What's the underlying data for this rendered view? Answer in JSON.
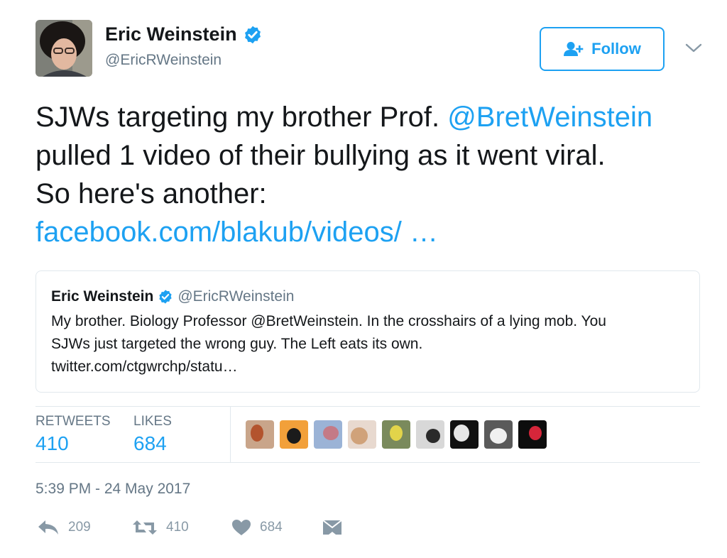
{
  "author": {
    "name": "Eric Weinstein",
    "handle": "@EricRWeinstein",
    "verified": true,
    "avatar_icon": "avatar-photo"
  },
  "follow_button": {
    "label": "Follow",
    "icon": "add-user-icon"
  },
  "menu_icon": "chevron-down-icon",
  "tweet": {
    "line1_text": "SJWs targeting my brother Prof. ",
    "line1_mention": "@BretWeinstein",
    "line2": "pulled 1 video of their bullying as it went viral.",
    "line3": "So here's another:",
    "link": "facebook.com/blakub/videos/ …"
  },
  "quoted_tweet": {
    "name": "Eric Weinstein",
    "handle": "@EricRWeinstein",
    "verified": true,
    "line1": "My brother. Biology Professor @BretWeinstein. In the crosshairs of a lying mob. You",
    "line2": "SJWs just targeted the wrong guy. The Left eats its own.",
    "line3": "twitter.com/ctgwrchp/statu…"
  },
  "stats": {
    "retweets_label": "RETWEETS",
    "retweets_value": "410",
    "likes_label": "LIKES",
    "likes_value": "684"
  },
  "likers": [
    {
      "name": "liker-1",
      "bg": "#c9a58a",
      "fg": "#b3542e"
    },
    {
      "name": "liker-2",
      "bg": "#f2a03a",
      "fg": "#1b1b1b"
    },
    {
      "name": "liker-3",
      "bg": "#9bb3d6",
      "fg": "#c47a86"
    },
    {
      "name": "liker-4",
      "bg": "#e8d9cf",
      "fg": "#d0a27a"
    },
    {
      "name": "liker-5",
      "bg": "#7a8a5c",
      "fg": "#e2d44a"
    },
    {
      "name": "liker-6",
      "bg": "#d8d8d8",
      "fg": "#2a2a2a"
    },
    {
      "name": "liker-7",
      "bg": "#111111",
      "fg": "#e6e6e6"
    },
    {
      "name": "liker-8",
      "bg": "#5a5a5a",
      "fg": "#f0f0f0"
    },
    {
      "name": "liker-9",
      "bg": "#0d0d0d",
      "fg": "#d6263a"
    }
  ],
  "timestamp": "5:39 PM - 24 May 2017",
  "actions": {
    "reply_count": "209",
    "retweet_count": "410",
    "like_count": "684"
  },
  "colors": {
    "accent": "#1da1f2",
    "muted": "#657786",
    "icon_gray": "#8899a6"
  }
}
